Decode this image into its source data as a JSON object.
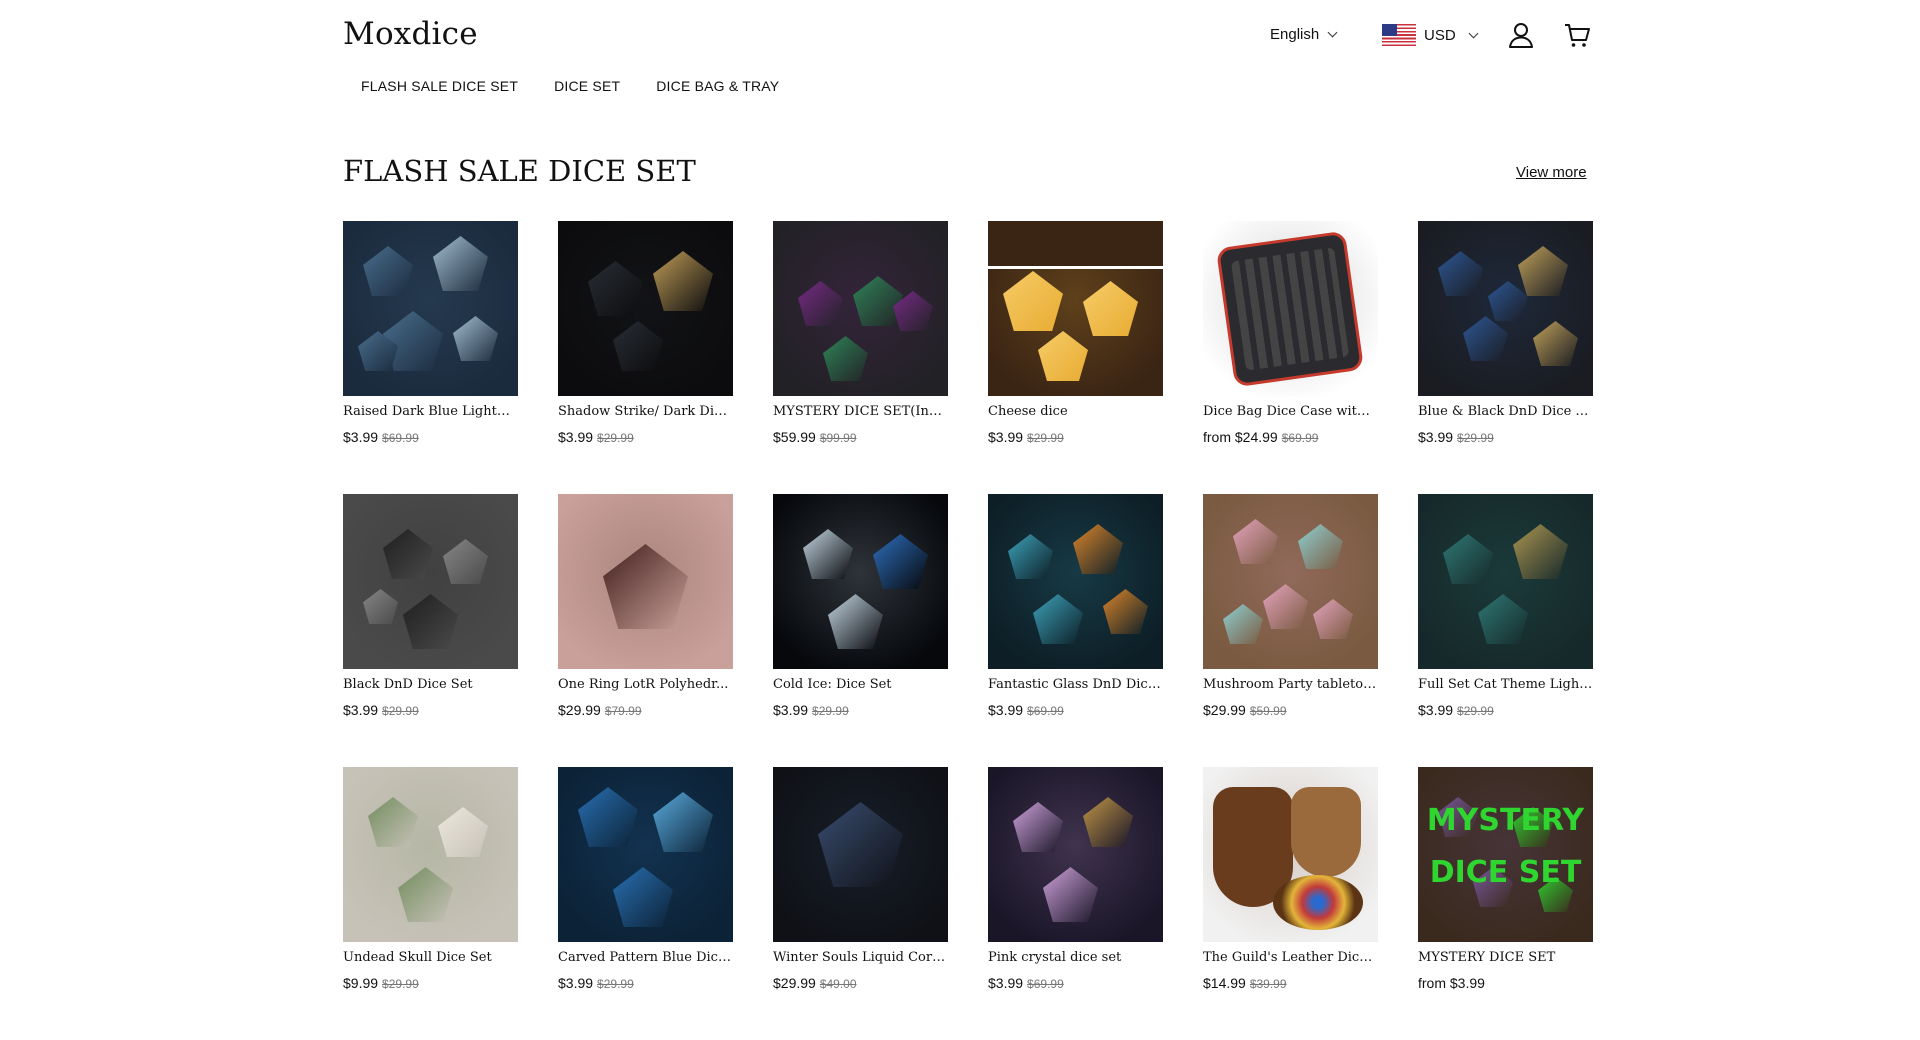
{
  "header": {
    "logo": "Moxdice",
    "language": "English",
    "currency": "USD",
    "account_icon": "user-icon",
    "cart_icon": "cart-icon"
  },
  "nav": {
    "items": [
      "FLASH SALE DICE SET",
      "DICE SET",
      "DICE BAG & TRAY"
    ]
  },
  "section": {
    "title": "FLASH SALE DICE SET",
    "view_more": "View more"
  },
  "products": [
    {
      "name": "Raised Dark Blue Lightni...",
      "price": "$3.99",
      "compare": "$69.99",
      "colors": [
        "#1b2b3e",
        "#4b7190",
        "#a9c5d6"
      ]
    },
    {
      "name": "Shadow Strike/ Dark Dice...",
      "price": "$3.99",
      "compare": "$29.99",
      "colors": [
        "#0c0c0e",
        "#2a2f36",
        "#c8a35a"
      ]
    },
    {
      "name": "MYSTERY DICE SET(Inclu...",
      "price": "$59.99",
      "compare": "$99.99",
      "colors": [
        "#222226",
        "#7b2a8a",
        "#2f8a5a"
      ]
    },
    {
      "name": "Cheese dice",
      "price": "$3.99",
      "compare": "$29.99",
      "colors": [
        "#3a2414",
        "#f0b234",
        "#ffd46b"
      ]
    },
    {
      "name": "Dice Bag Dice Case with ...",
      "price": "from $24.99",
      "compare": "$69.99",
      "colors": [
        "#ffffff",
        "#2b2b2f",
        "#c53a2c"
      ]
    },
    {
      "name": "Blue & Black DnD Dice Set",
      "price": "$3.99",
      "compare": "$29.99",
      "colors": [
        "#1a1c22",
        "#2e5a9a",
        "#c9a75c"
      ]
    },
    {
      "name": "Black DnD Dice Set",
      "price": "$3.99",
      "compare": "$29.99",
      "colors": [
        "#4a4a4a",
        "#1c1c1c",
        "#8a8a8a"
      ]
    },
    {
      "name": "One Ring LotR Polyhedr...",
      "price": "$29.99",
      "compare": "$79.99",
      "colors": [
        "#c9a09a",
        "#3a1714",
        "#d7a43c"
      ]
    },
    {
      "name": "Cold Ice: Dice Set",
      "price": "$3.99",
      "compare": "$29.99",
      "colors": [
        "#06080c",
        "#cfe1ee",
        "#2e72c4"
      ]
    },
    {
      "name": "Fantastic Glass DnD Dice ...",
      "price": "$3.99",
      "compare": "$69.99",
      "colors": [
        "#0d1e26",
        "#3fa8c0",
        "#e68a2a"
      ]
    },
    {
      "name": "Mushroom Party tabletop...",
      "price": "$29.99",
      "compare": "$59.99",
      "colors": [
        "#7a5a40",
        "#e9a7c4",
        "#8fd6d9"
      ]
    },
    {
      "name": "Full Set Cat Theme Light ...",
      "price": "$3.99",
      "compare": "$29.99",
      "colors": [
        "#16292a",
        "#2f7c78",
        "#b49a52"
      ]
    },
    {
      "name": "Undead Skull Dice Set",
      "price": "$9.99",
      "compare": "$29.99",
      "colors": [
        "#c7c2b8",
        "#6f8a5a",
        "#f0ebe0"
      ]
    },
    {
      "name": "Carved Pattern Blue Dice ...",
      "price": "$3.99",
      "compare": "$29.99",
      "colors": [
        "#0c2236",
        "#2a73b8",
        "#5db2e6"
      ]
    },
    {
      "name": "Winter Souls Liquid Core ...",
      "price": "$29.99",
      "compare": "$49.00",
      "colors": [
        "#0f1116",
        "#3b4f74",
        "#d4d8e6"
      ]
    },
    {
      "name": "Pink crystal dice set",
      "price": "$3.99",
      "compare": "$69.99",
      "colors": [
        "#1a1628",
        "#d7a8e4",
        "#c79a46"
      ]
    },
    {
      "name": "The Guild's Leather Dice ...",
      "price": "$14.99",
      "compare": "$39.99",
      "colors": [
        "#f1f1f1",
        "#6a3c1e",
        "#9b6a3c"
      ]
    },
    {
      "name": "MYSTERY DICE SET",
      "price": "from $3.99",
      "compare": "",
      "colors": [
        "#3a2a1e",
        "#7a5aa0",
        "#2fd62f"
      ]
    }
  ]
}
